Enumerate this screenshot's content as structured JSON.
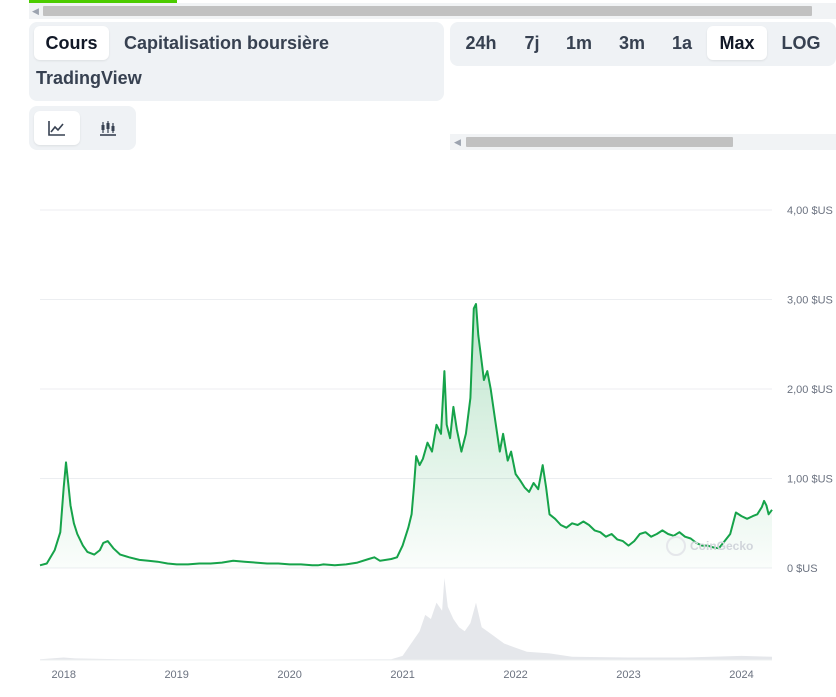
{
  "tabs": {
    "price": "Cours",
    "market_cap": "Capitalisation boursière",
    "tradingview": "TradingView"
  },
  "ranges": [
    "24h",
    "7j",
    "1m",
    "3m",
    "1a",
    "Max",
    "LOG"
  ],
  "active_range": "Max",
  "chart_types": [
    {
      "icon": "line-chart-icon",
      "active": true
    },
    {
      "icon": "candlestick-icon",
      "active": false
    }
  ],
  "watermark": "CoinGecko",
  "colors": {
    "line": "#16a34a",
    "fill": "#16a34a",
    "volume": "#e5e7eb",
    "panel": "#eff2f5"
  },
  "chart_data": {
    "type": "line",
    "title": "",
    "xlabel": "",
    "ylabel": "",
    "ylim": [
      0,
      4
    ],
    "y_ticks": [
      {
        "value": 0,
        "label": "0 $US"
      },
      {
        "value": 1,
        "label": "1,00 $US"
      },
      {
        "value": 2,
        "label": "2,00 $US"
      },
      {
        "value": 3,
        "label": "3,00 $US"
      },
      {
        "value": 4,
        "label": "4,00 $US"
      }
    ],
    "x_ticks": [
      {
        "value": 2018.0,
        "label": "2018"
      },
      {
        "value": 2019.0,
        "label": "2019"
      },
      {
        "value": 2020.0,
        "label": "2020"
      },
      {
        "value": 2021.0,
        "label": "2021"
      },
      {
        "value": 2022.0,
        "label": "2022"
      },
      {
        "value": 2023.0,
        "label": "2023"
      },
      {
        "value": 2024.0,
        "label": "2024"
      }
    ],
    "xlim": [
      2017.79,
      2024.27
    ],
    "grid": true,
    "series": [
      {
        "points": [
          [
            2017.79,
            0.03
          ],
          [
            2017.85,
            0.05
          ],
          [
            2017.92,
            0.2
          ],
          [
            2017.97,
            0.4
          ],
          [
            2018.0,
            0.9
          ],
          [
            2018.02,
            1.18
          ],
          [
            2018.04,
            0.95
          ],
          [
            2018.06,
            0.7
          ],
          [
            2018.09,
            0.5
          ],
          [
            2018.12,
            0.38
          ],
          [
            2018.17,
            0.25
          ],
          [
            2018.21,
            0.18
          ],
          [
            2018.27,
            0.15
          ],
          [
            2018.32,
            0.2
          ],
          [
            2018.35,
            0.28
          ],
          [
            2018.39,
            0.3
          ],
          [
            2018.44,
            0.22
          ],
          [
            2018.5,
            0.15
          ],
          [
            2018.58,
            0.12
          ],
          [
            2018.67,
            0.09
          ],
          [
            2018.75,
            0.08
          ],
          [
            2018.83,
            0.07
          ],
          [
            2018.92,
            0.05
          ],
          [
            2019.0,
            0.04
          ],
          [
            2019.1,
            0.04
          ],
          [
            2019.2,
            0.05
          ],
          [
            2019.3,
            0.05
          ],
          [
            2019.4,
            0.06
          ],
          [
            2019.5,
            0.08
          ],
          [
            2019.6,
            0.07
          ],
          [
            2019.7,
            0.06
          ],
          [
            2019.8,
            0.05
          ],
          [
            2019.9,
            0.05
          ],
          [
            2020.0,
            0.04
          ],
          [
            2020.1,
            0.04
          ],
          [
            2020.2,
            0.03
          ],
          [
            2020.25,
            0.03
          ],
          [
            2020.3,
            0.04
          ],
          [
            2020.4,
            0.03
          ],
          [
            2020.5,
            0.04
          ],
          [
            2020.6,
            0.06
          ],
          [
            2020.7,
            0.1
          ],
          [
            2020.75,
            0.12
          ],
          [
            2020.8,
            0.08
          ],
          [
            2020.9,
            0.1
          ],
          [
            2020.95,
            0.12
          ],
          [
            2021.0,
            0.25
          ],
          [
            2021.05,
            0.45
          ],
          [
            2021.08,
            0.6
          ],
          [
            2021.1,
            0.9
          ],
          [
            2021.12,
            1.25
          ],
          [
            2021.15,
            1.15
          ],
          [
            2021.18,
            1.22
          ],
          [
            2021.22,
            1.4
          ],
          [
            2021.26,
            1.3
          ],
          [
            2021.3,
            1.6
          ],
          [
            2021.34,
            1.5
          ],
          [
            2021.37,
            2.2
          ],
          [
            2021.39,
            1.6
          ],
          [
            2021.42,
            1.45
          ],
          [
            2021.45,
            1.8
          ],
          [
            2021.48,
            1.55
          ],
          [
            2021.52,
            1.3
          ],
          [
            2021.56,
            1.5
          ],
          [
            2021.6,
            1.9
          ],
          [
            2021.63,
            2.9
          ],
          [
            2021.65,
            2.95
          ],
          [
            2021.67,
            2.6
          ],
          [
            2021.7,
            2.3
          ],
          [
            2021.72,
            2.1
          ],
          [
            2021.75,
            2.2
          ],
          [
            2021.78,
            2.0
          ],
          [
            2021.82,
            1.65
          ],
          [
            2021.86,
            1.3
          ],
          [
            2021.89,
            1.5
          ],
          [
            2021.93,
            1.2
          ],
          [
            2021.96,
            1.3
          ],
          [
            2022.0,
            1.05
          ],
          [
            2022.04,
            0.98
          ],
          [
            2022.08,
            0.9
          ],
          [
            2022.12,
            0.85
          ],
          [
            2022.16,
            0.95
          ],
          [
            2022.2,
            0.88
          ],
          [
            2022.24,
            1.15
          ],
          [
            2022.27,
            0.9
          ],
          [
            2022.3,
            0.6
          ],
          [
            2022.35,
            0.55
          ],
          [
            2022.4,
            0.48
          ],
          [
            2022.45,
            0.45
          ],
          [
            2022.5,
            0.5
          ],
          [
            2022.55,
            0.48
          ],
          [
            2022.6,
            0.52
          ],
          [
            2022.65,
            0.48
          ],
          [
            2022.7,
            0.42
          ],
          [
            2022.75,
            0.4
          ],
          [
            2022.8,
            0.35
          ],
          [
            2022.85,
            0.38
          ],
          [
            2022.9,
            0.32
          ],
          [
            2022.95,
            0.3
          ],
          [
            2023.0,
            0.25
          ],
          [
            2023.05,
            0.3
          ],
          [
            2023.1,
            0.38
          ],
          [
            2023.15,
            0.4
          ],
          [
            2023.2,
            0.35
          ],
          [
            2023.25,
            0.38
          ],
          [
            2023.3,
            0.42
          ],
          [
            2023.35,
            0.38
          ],
          [
            2023.4,
            0.36
          ],
          [
            2023.45,
            0.4
          ],
          [
            2023.5,
            0.35
          ],
          [
            2023.55,
            0.33
          ],
          [
            2023.6,
            0.28
          ],
          [
            2023.65,
            0.25
          ],
          [
            2023.7,
            0.25
          ],
          [
            2023.75,
            0.23
          ],
          [
            2023.8,
            0.22
          ],
          [
            2023.85,
            0.3
          ],
          [
            2023.9,
            0.38
          ],
          [
            2023.95,
            0.62
          ],
          [
            2024.0,
            0.58
          ],
          [
            2024.05,
            0.55
          ],
          [
            2024.1,
            0.58
          ],
          [
            2024.14,
            0.6
          ],
          [
            2024.18,
            0.68
          ],
          [
            2024.2,
            0.75
          ],
          [
            2024.22,
            0.7
          ],
          [
            2024.24,
            0.6
          ],
          [
            2024.27,
            0.65
          ]
        ]
      }
    ],
    "volume": {
      "points": [
        [
          2017.79,
          0.01
        ],
        [
          2018.0,
          0.03
        ],
        [
          2018.1,
          0.02
        ],
        [
          2018.5,
          0.01
        ],
        [
          2019.0,
          0.005
        ],
        [
          2020.0,
          0.005
        ],
        [
          2020.9,
          0.01
        ],
        [
          2021.0,
          0.05
        ],
        [
          2021.1,
          0.25
        ],
        [
          2021.15,
          0.35
        ],
        [
          2021.2,
          0.55
        ],
        [
          2021.25,
          0.5
        ],
        [
          2021.3,
          0.7
        ],
        [
          2021.35,
          0.6
        ],
        [
          2021.37,
          1.0
        ],
        [
          2021.4,
          0.65
        ],
        [
          2021.45,
          0.5
        ],
        [
          2021.5,
          0.4
        ],
        [
          2021.55,
          0.35
        ],
        [
          2021.6,
          0.45
        ],
        [
          2021.65,
          0.7
        ],
        [
          2021.7,
          0.4
        ],
        [
          2021.75,
          0.35
        ],
        [
          2021.8,
          0.3
        ],
        [
          2021.85,
          0.25
        ],
        [
          2021.9,
          0.2
        ],
        [
          2022.0,
          0.15
        ],
        [
          2022.1,
          0.1
        ],
        [
          2022.3,
          0.08
        ],
        [
          2022.5,
          0.04
        ],
        [
          2023.0,
          0.03
        ],
        [
          2023.5,
          0.03
        ],
        [
          2024.0,
          0.05
        ],
        [
          2024.27,
          0.04
        ]
      ]
    }
  }
}
